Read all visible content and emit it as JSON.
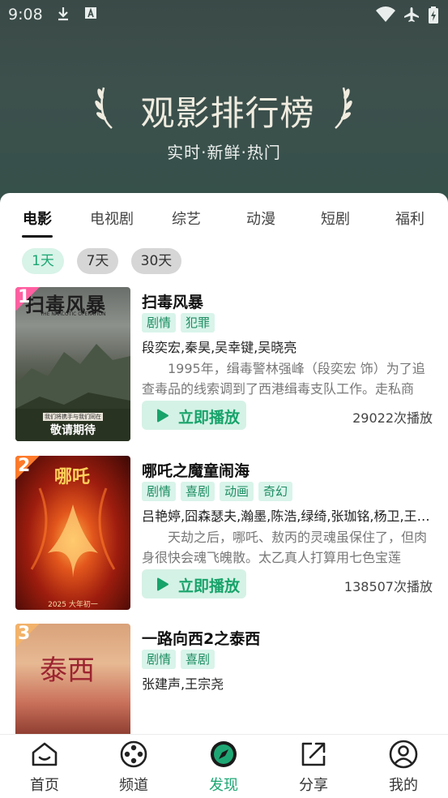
{
  "status_bar": {
    "time": "9:08"
  },
  "hero": {
    "title": "观影排行榜",
    "subtitle": "实时·新鲜·热门"
  },
  "tabs": [
    {
      "label": "电影"
    },
    {
      "label": "电视剧"
    },
    {
      "label": "综艺"
    },
    {
      "label": "动漫"
    },
    {
      "label": "短剧"
    },
    {
      "label": "福利"
    }
  ],
  "periods": [
    {
      "label": "1天"
    },
    {
      "label": "7天"
    },
    {
      "label": "30天"
    }
  ],
  "items": [
    {
      "rank": "1",
      "title": "扫毒风暴",
      "tags": [
        "剧情",
        "犯罪"
      ],
      "cast": "段奕宏,秦昊,吴幸键,吴晓亮",
      "desc": "1995年，缉毒警林强峰（段奕宏 饰）为了追查毒品的线索调到了西港缉毒支队工作。走私商",
      "play_label": "立即播放",
      "play_count": "29022次播放",
      "poster_text_top": "扫毒风暴",
      "poster_text_sub": "THE NARCOTIC OPERATION",
      "poster_text_bottom": "敬请期待",
      "poster_text_small": "我们将携手与我们同在"
    },
    {
      "rank": "2",
      "title": "哪吒之魔童闹海",
      "tags": [
        "剧情",
        "喜剧",
        "动画",
        "奇幻"
      ],
      "cast": "吕艳婷,囧森瑟夫,瀚墨,陈浩,绿绮,张珈铭,杨卫,王…",
      "desc": "天劫之后，哪吒、敖丙的灵魂虽保住了，但肉身很快会魂飞魄散。太乙真人打算用七色宝莲",
      "play_label": "立即播放",
      "play_count": "138507次播放",
      "poster_text_top": "哪吒",
      "poster_text_bottom": "2025 大年初一"
    },
    {
      "rank": "3",
      "title": "一路向西2之泰西",
      "tags": [
        "剧情",
        "喜剧"
      ],
      "cast": "张建声,王宗尧",
      "poster_text_top": "泰西"
    }
  ],
  "bottom_nav": [
    {
      "label": "首页",
      "icon": "home-icon"
    },
    {
      "label": "频道",
      "icon": "film-reel-icon"
    },
    {
      "label": "发现",
      "icon": "compass-icon"
    },
    {
      "label": "分享",
      "icon": "share-icon"
    },
    {
      "label": "我的",
      "icon": "profile-icon"
    }
  ],
  "colors": {
    "accent": "#1ea774",
    "tag_bg": "#d9f4ea",
    "hero_bg": "#3d504c",
    "rank_badge": "#ff5fa0"
  }
}
